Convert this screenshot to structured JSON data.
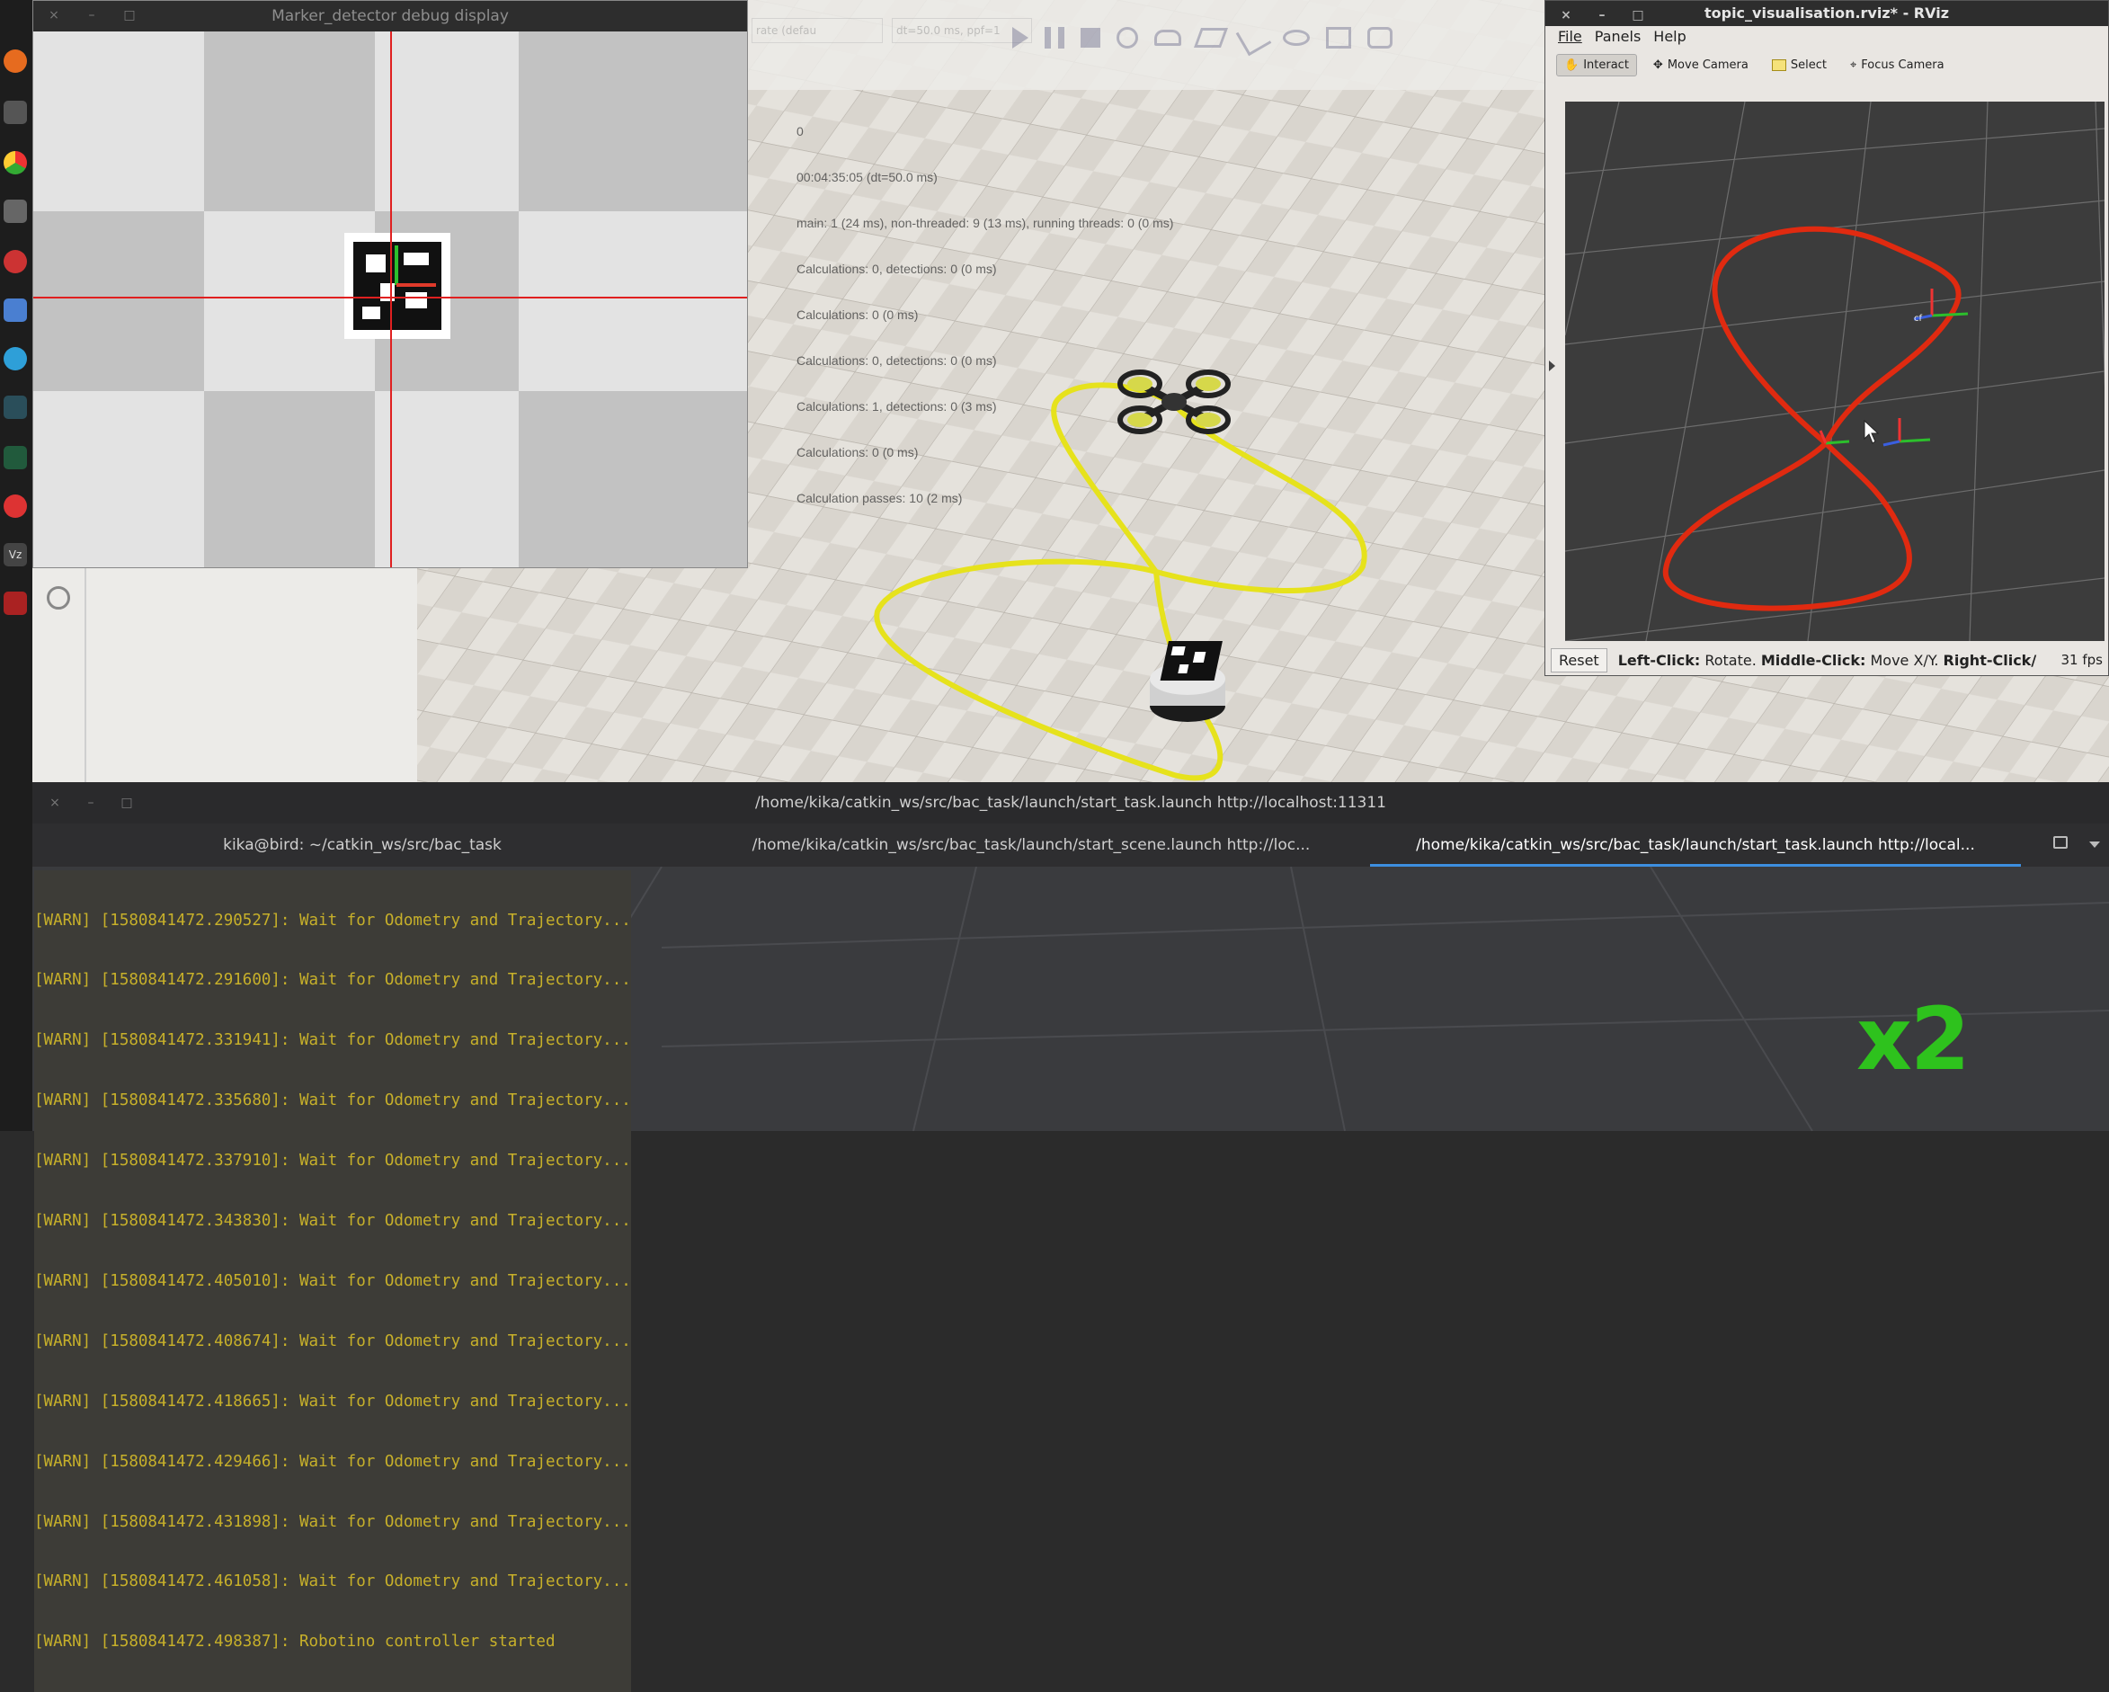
{
  "marker_window": {
    "title": "Marker_detector debug display"
  },
  "rviz": {
    "title": "topic_visualisation.rviz* - RViz",
    "menu": [
      "File",
      "Panels",
      "Help"
    ],
    "tools": [
      {
        "label": "Interact",
        "icon": "hand-icon"
      },
      {
        "label": "Move Camera",
        "icon": "move-camera-icon"
      },
      {
        "label": "Select",
        "icon": "select-icon"
      },
      {
        "label": "Focus Camera",
        "icon": "focus-camera-icon"
      }
    ],
    "reset_label": "Reset",
    "hint_left_key": "Left-Click:",
    "hint_left_text": " Rotate. ",
    "hint_middle_key": "Middle-Click:",
    "hint_middle_text": " Move X/Y. ",
    "hint_right_key": "Right-Click/",
    "fps": "31 fps"
  },
  "gazebo": {
    "toolbar_fields": [
      "rate (defau",
      "dt=50.0 ms, ppf=1"
    ],
    "stats": [
      "0",
      "00:04:35:05 (dt=50.0 ms)",
      "main: 1 (24 ms), non-threaded: 9 (13 ms), running threads: 0 (0 ms)",
      "Calculations: 0, detections: 0 (0 ms)",
      "Calculations: 0 (0 ms)",
      "Calculations: 0, detections: 0 (0 ms)",
      "Calculations: 1, detections: 0 (3 ms)",
      "Calculations: 0 (0 ms)",
      "Calculation passes: 10 (2 ms)"
    ]
  },
  "terminal": {
    "title": "/home/kika/catkin_ws/src/bac_task/launch/start_task.launch http://localhost:11311",
    "tabs": [
      {
        "label": "kika@bird: ~/catkin_ws/src/bac_task",
        "active": false
      },
      {
        "label": "/home/kika/catkin_ws/src/bac_task/launch/start_scene.launch http://loc...",
        "active": false
      },
      {
        "label": "/home/kika/catkin_ws/src/bac_task/launch/start_task.launch http://local...",
        "active": true
      }
    ],
    "lines": [
      "[WARN] [1580841472.290527]: Wait for Odometry and Trajectory...",
      "[WARN] [1580841472.291600]: Wait for Odometry and Trajectory...",
      "[WARN] [1580841472.331941]: Wait for Odometry and Trajectory...",
      "[WARN] [1580841472.335680]: Wait for Odometry and Trajectory...",
      "[WARN] [1580841472.337910]: Wait for Odometry and Trajectory...",
      "[WARN] [1580841472.343830]: Wait for Odometry and Trajectory...",
      "[WARN] [1580841472.405010]: Wait for Odometry and Trajectory...",
      "[WARN] [1580841472.408674]: Wait for Odometry and Trajectory...",
      "[WARN] [1580841472.418665]: Wait for Odometry and Trajectory...",
      "[WARN] [1580841472.429466]: Wait for Odometry and Trajectory...",
      "[WARN] [1580841472.431898]: Wait for Odometry and Trajectory...",
      "[WARN] [1580841472.461058]: Wait for Odometry and Trajectory...",
      "[WARN] [1580841472.498387]: Robotino controller started"
    ]
  },
  "overlay": {
    "speed": "x2"
  },
  "colors": {
    "trajectory_yellow": "#e6e21c",
    "rviz_trajectory_red": "#e02a10",
    "terminal_text": "#c7b02a",
    "speed_green": "#2ec21d"
  }
}
